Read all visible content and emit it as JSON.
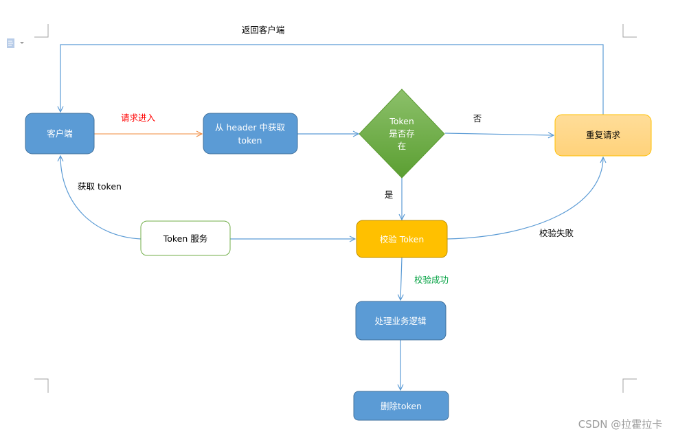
{
  "nodes": {
    "client": "客户端",
    "get_header": [
      "从 header 中获取",
      "token"
    ],
    "decision": [
      "Token",
      "是否存",
      "在"
    ],
    "retry": "重复请求",
    "token_service": "Token 服务",
    "validate": "校验 Token",
    "business": "处理业务逻辑",
    "delete": "删除token"
  },
  "edges": {
    "return_client": "返回客户端",
    "request_in": "请求进入",
    "no": "否",
    "yes": "是",
    "get_token": "获取 token",
    "validate_fail": "校验失败",
    "validate_success": "校验成功"
  },
  "watermark": "CSDN @拉霍拉卡",
  "colors": {
    "blue": "#5b9bd5",
    "green": "#6aaa3d",
    "orange": "#ffc000",
    "light_orange": "#ffd98a",
    "edge": "#5b9bd5",
    "request_edge": "#f4a460",
    "request_label": "#ff0000",
    "success_label": "#00a040"
  }
}
